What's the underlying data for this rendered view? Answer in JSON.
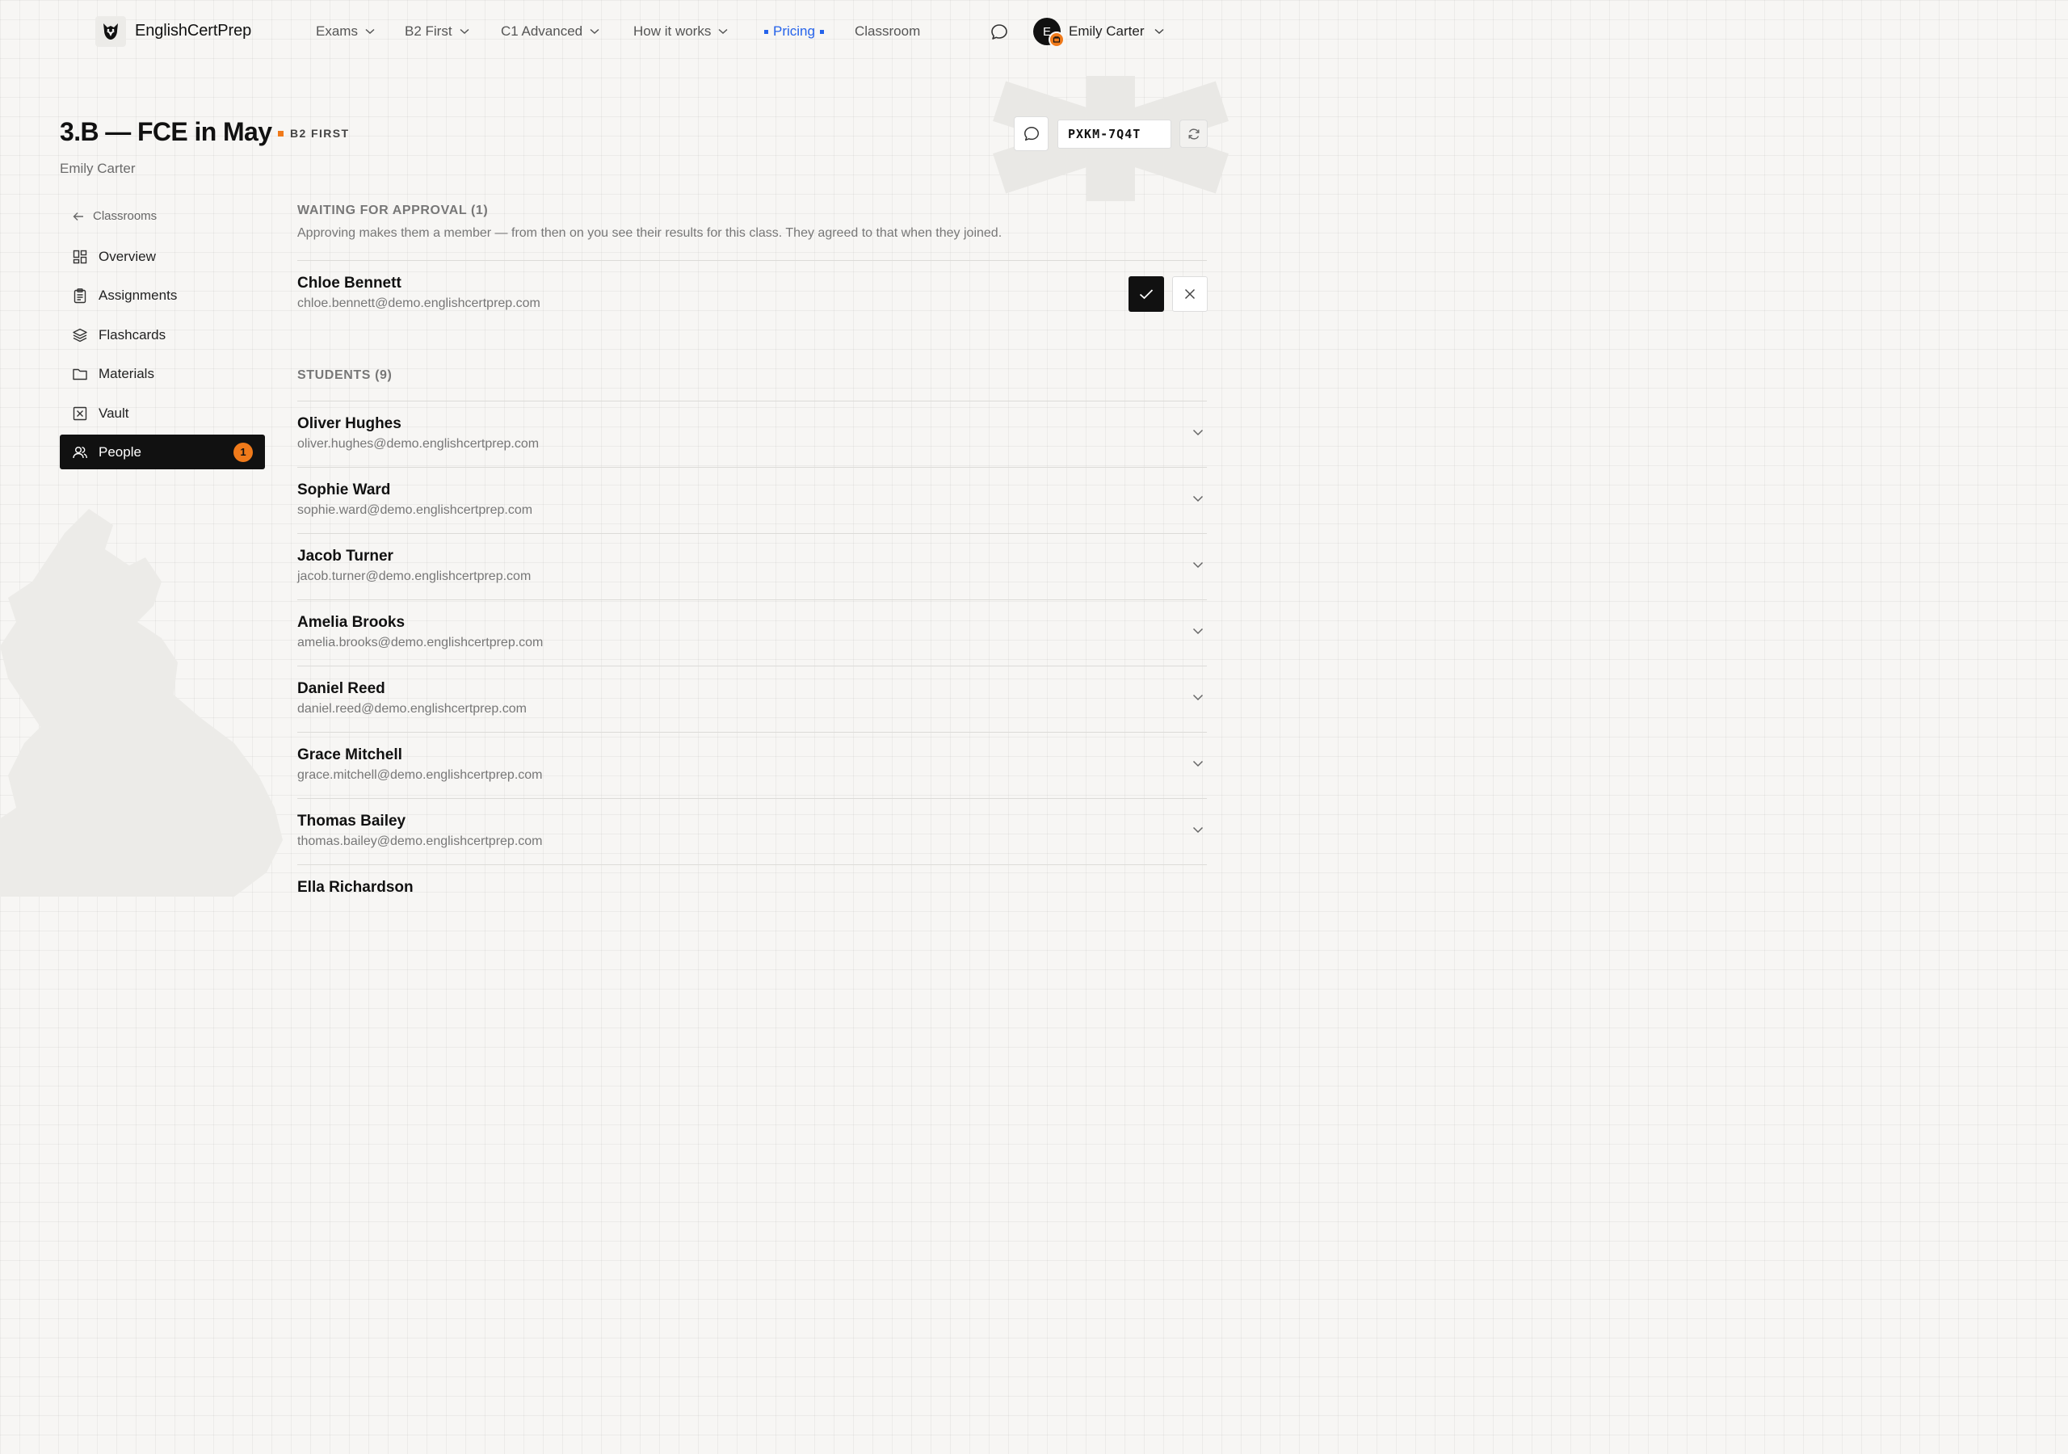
{
  "nav": {
    "brand": "EnglishCertPrep",
    "items": [
      {
        "label": "Exams",
        "dropdown": true
      },
      {
        "label": "B2 First",
        "dropdown": true
      },
      {
        "label": "C1 Advanced",
        "dropdown": true
      },
      {
        "label": "How it works",
        "dropdown": true
      },
      {
        "label": "Pricing",
        "active": true
      },
      {
        "label": "Classroom"
      }
    ],
    "user": {
      "initial": "E",
      "name": "Emily Carter"
    }
  },
  "header": {
    "title": "3.B — FCE in May",
    "level": "B2 FIRST",
    "teacher": "Emily Carter",
    "join_code": "PXKM-7Q4T"
  },
  "sidebar": {
    "back_label": "Classrooms",
    "items": [
      {
        "label": "Overview",
        "icon": "grid-icon"
      },
      {
        "label": "Assignments",
        "icon": "clipboard-icon"
      },
      {
        "label": "Flashcards",
        "icon": "layers-icon"
      },
      {
        "label": "Materials",
        "icon": "folder-icon"
      },
      {
        "label": "Vault",
        "icon": "vault-icon"
      },
      {
        "label": "People",
        "icon": "people-icon",
        "active": true,
        "count": "1"
      }
    ]
  },
  "waiting": {
    "heading": "WAITING FOR APPROVAL (1)",
    "description": "Approving makes them a member — from then on you see their results for this class. They agreed to that when they joined.",
    "people": [
      {
        "name": "Chloe Bennett",
        "email": "chloe.bennett@demo.englishcertprep.com"
      }
    ]
  },
  "students": {
    "heading": "STUDENTS (9)",
    "list": [
      {
        "name": "Oliver Hughes",
        "email": "oliver.hughes@demo.englishcertprep.com"
      },
      {
        "name": "Sophie Ward",
        "email": "sophie.ward@demo.englishcertprep.com"
      },
      {
        "name": "Jacob Turner",
        "email": "jacob.turner@demo.englishcertprep.com"
      },
      {
        "name": "Amelia Brooks",
        "email": "amelia.brooks@demo.englishcertprep.com"
      },
      {
        "name": "Daniel Reed",
        "email": "daniel.reed@demo.englishcertprep.com"
      },
      {
        "name": "Grace Mitchell",
        "email": "grace.mitchell@demo.englishcertprep.com"
      },
      {
        "name": "Thomas Bailey",
        "email": "thomas.bailey@demo.englishcertprep.com"
      },
      {
        "name": "Ella Richardson",
        "email": ""
      }
    ]
  },
  "colors": {
    "accent": "#2563eb",
    "orange": "#f07a1a",
    "dark": "#111111"
  }
}
